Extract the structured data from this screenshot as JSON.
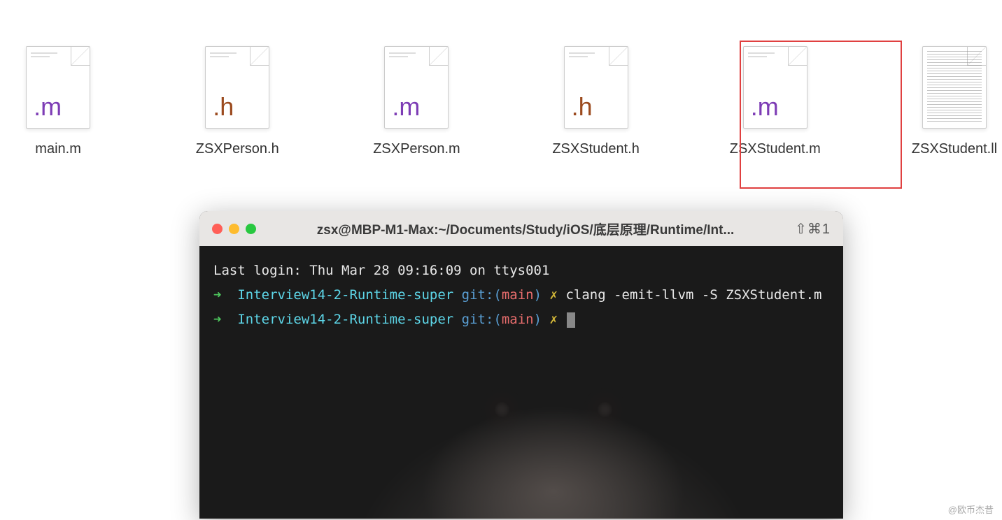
{
  "finder": {
    "files": [
      {
        "name": "main.m",
        "ext": ".m",
        "type": "m"
      },
      {
        "name": "ZSXPerson.h",
        "ext": ".h",
        "type": "h"
      },
      {
        "name": "ZSXPerson.m",
        "ext": ".m",
        "type": "m"
      },
      {
        "name": "ZSXStudent.h",
        "ext": ".h",
        "type": "h"
      },
      {
        "name": "ZSXStudent.m",
        "ext": ".m",
        "type": "m"
      },
      {
        "name": "ZSXStudent.ll",
        "ext": "",
        "type": "ll"
      }
    ]
  },
  "terminal": {
    "title": "zsx@MBP-M1-Max:~/Documents/Study/iOS/底层原理/Runtime/Int...",
    "right_indicator": "⇧⌘1",
    "last_login": "Last login: Thu Mar 28 09:16:09 on ttys001",
    "prompt_arrow": "➜",
    "prompt_dir": "Interview14-2-Runtime-super",
    "prompt_git": "git:(",
    "prompt_branch": "main",
    "prompt_git_close": ")",
    "prompt_dirty": "✗",
    "command": "clang -emit-llvm -S ZSXStudent.m"
  },
  "watermark": "@欧币杰昔"
}
